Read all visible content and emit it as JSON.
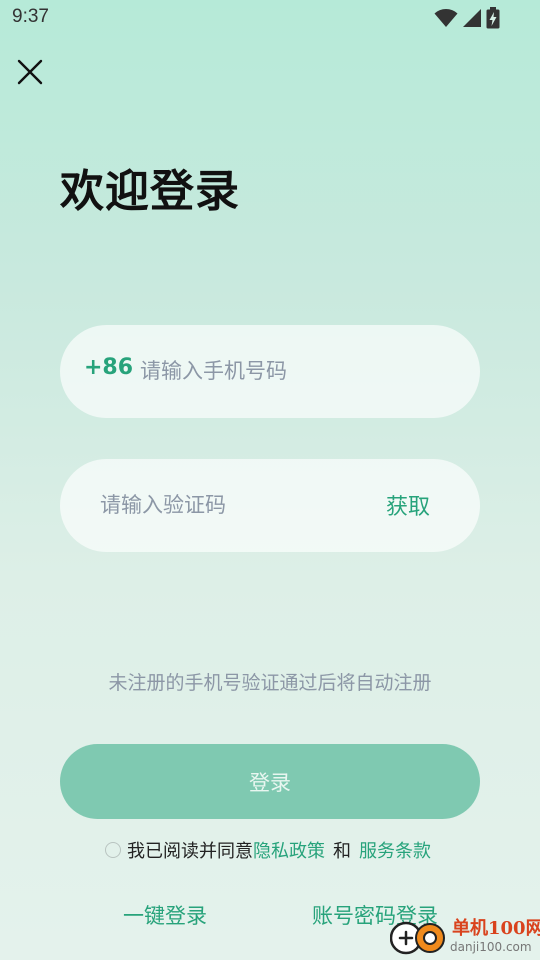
{
  "status_bar": {
    "time": "9:37",
    "icons": [
      "wifi-icon",
      "cell-signal-icon",
      "battery-charging-icon"
    ]
  },
  "header": {
    "close_icon": "close-icon",
    "title": "欢迎登录"
  },
  "form": {
    "phone": {
      "country_code": "+86",
      "placeholder": "请输入手机号码",
      "value": ""
    },
    "code": {
      "placeholder": "请输入验证码",
      "value": "",
      "get_code_label": "获取"
    },
    "hint": "未注册的手机号验证通过后将自动注册",
    "login_label": "登录",
    "agreement": {
      "prefix": "我已阅读并同意",
      "privacy_link": "隐私政策",
      "and": "和",
      "terms_link": "服务条款"
    }
  },
  "alt_login": {
    "one_tap": "一键登录",
    "password": "账号密码登录"
  },
  "watermark": {
    "name": "单机100网",
    "url": "danji100.com"
  },
  "colors": {
    "accent": "#27a37b",
    "login_button": "#7fc9b1",
    "placeholder": "#8c97a6"
  }
}
